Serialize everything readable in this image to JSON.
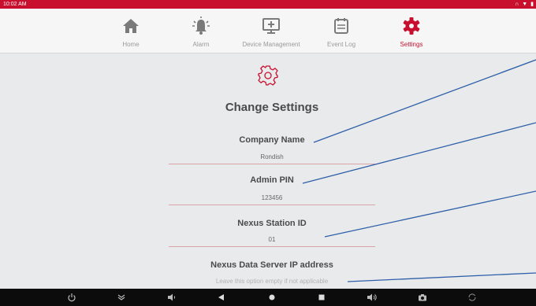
{
  "status_bar": {
    "time": "10:02 AM",
    "status_icons": [
      "headphones-icon",
      "wifi-icon",
      "battery-icon"
    ]
  },
  "nav": {
    "tabs": [
      {
        "label": "Home",
        "icon": "home-icon",
        "active": false
      },
      {
        "label": "Alarm",
        "icon": "alarm-bell-icon",
        "active": false
      },
      {
        "label": "Device Management",
        "icon": "monitor-plus-icon",
        "active": false
      },
      {
        "label": "Event Log",
        "icon": "calendar-list-icon",
        "active": false
      },
      {
        "label": "Settings",
        "icon": "gear-icon",
        "active": true
      }
    ]
  },
  "settings": {
    "title": "Change Settings",
    "fields": [
      {
        "label": "Company Name",
        "value": "Rondish"
      },
      {
        "label": "Admin PIN",
        "value": "123456"
      },
      {
        "label": "Nexus Station ID",
        "value": "01"
      },
      {
        "label": "Nexus Data Server IP address",
        "value": "",
        "placeholder": "Leave this option empty if not applicable"
      }
    ]
  },
  "system_nav": {
    "buttons": [
      "power-icon",
      "expand-down-icon",
      "volume-down-icon",
      "back-icon",
      "home-dot-icon",
      "recents-icon",
      "volume-up-icon",
      "camera-icon",
      "rotate-icon"
    ]
  },
  "colors": {
    "accent": "#c8102e",
    "inactive_icon": "#7a7a7a",
    "callout_line": "#2e5fa8",
    "background": "#e9eaec"
  }
}
